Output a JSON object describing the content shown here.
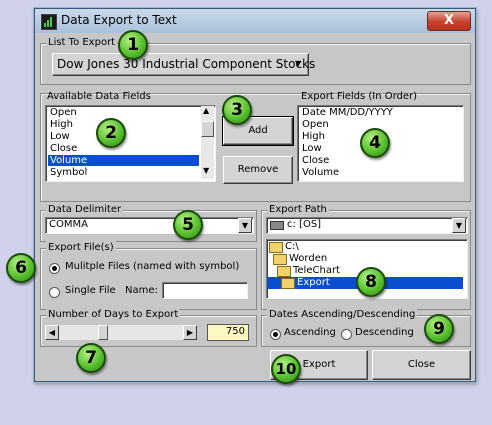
{
  "window": {
    "title": "Data Export to Text",
    "close_glyph": "X"
  },
  "list_to_export": {
    "group_label": "List To Export",
    "selected": "Dow Jones 30 Industrial Component Stocks"
  },
  "available_fields": {
    "group_label": "Available Data Fields",
    "items": [
      "Open",
      "High",
      "Low",
      "Close",
      "Volume",
      "Symbol"
    ],
    "selected_index": 4
  },
  "buttons": {
    "add": "Add",
    "remove": "Remove",
    "export": "Export",
    "close": "Close"
  },
  "export_fields": {
    "label": "Export Fields (In Order)",
    "items": [
      "Date MM/DD/YYYY",
      "Open",
      "High",
      "Low",
      "Close",
      "Volume"
    ]
  },
  "delimiter": {
    "group_label": "Data Delimiter",
    "selected": "COMMA"
  },
  "export_path": {
    "group_label": "Export Path",
    "drive": "c: [OS]",
    "folders": [
      "C:\\",
      "Worden",
      "TeleChart",
      "Export"
    ],
    "selected_folder_index": 3
  },
  "export_files": {
    "group_label": "Export File(s)",
    "multiple_label": "Mulitple Files (named with symbol)",
    "single_label": "Single File",
    "name_label": "Name:",
    "name_value": "",
    "selected": "multiple"
  },
  "days": {
    "group_label": "Number of Days to Export",
    "value": "750",
    "slider_fraction": 0.34
  },
  "sort": {
    "group_label": "Dates Ascending/Descending",
    "ascending": "Ascending",
    "descending": "Descending",
    "selected": "ascending"
  },
  "badges": [
    "1",
    "2",
    "3",
    "4",
    "5",
    "6",
    "7",
    "8",
    "9",
    "10"
  ],
  "colors": {
    "selection": "#0a4fd0",
    "badge": "#59c22f",
    "days_value_bg": "#fdf7c2",
    "close_button": "#c8412c"
  }
}
